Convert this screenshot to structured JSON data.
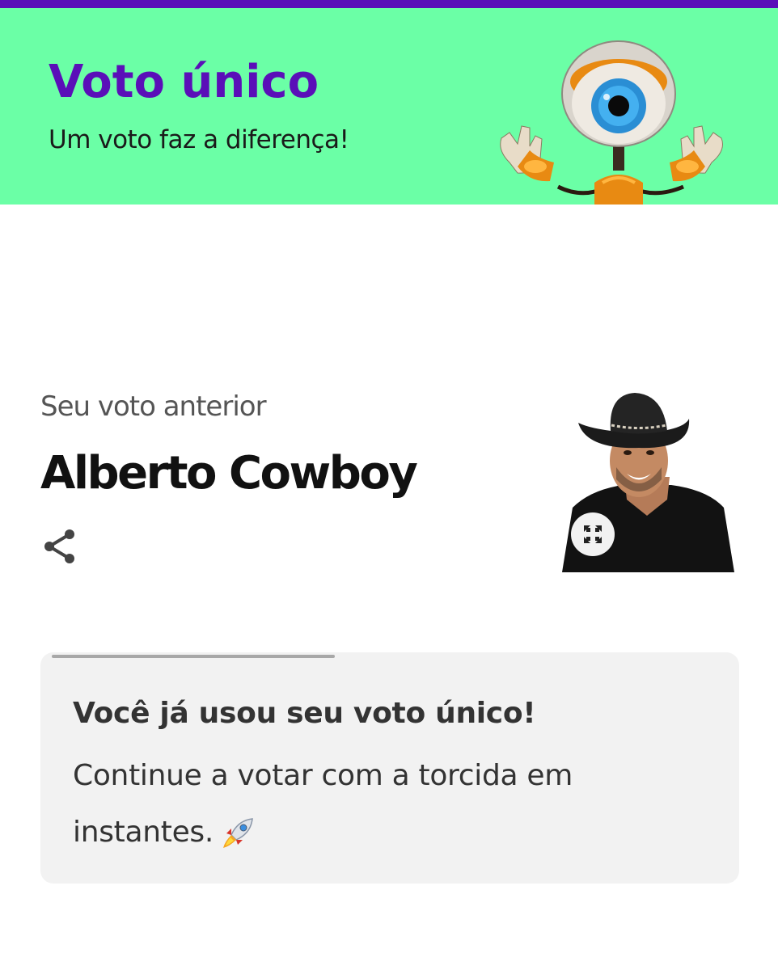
{
  "header": {
    "title": "Voto único",
    "subtitle": "Um voto faz a diferença!",
    "colors": {
      "background": "#6bffa6",
      "title": "#5a0fb8",
      "top_bar": "#5a0fb8"
    }
  },
  "previous_vote": {
    "label": "Seu voto anterior",
    "candidate_name": "Alberto Cowboy",
    "icons": {
      "share": "share-icon",
      "expand": "expand-icon"
    }
  },
  "notice": {
    "title": "Você já usou seu voto único!",
    "body": "Continue a votar com a torcida em instantes.",
    "emoji": "rocket-icon"
  }
}
